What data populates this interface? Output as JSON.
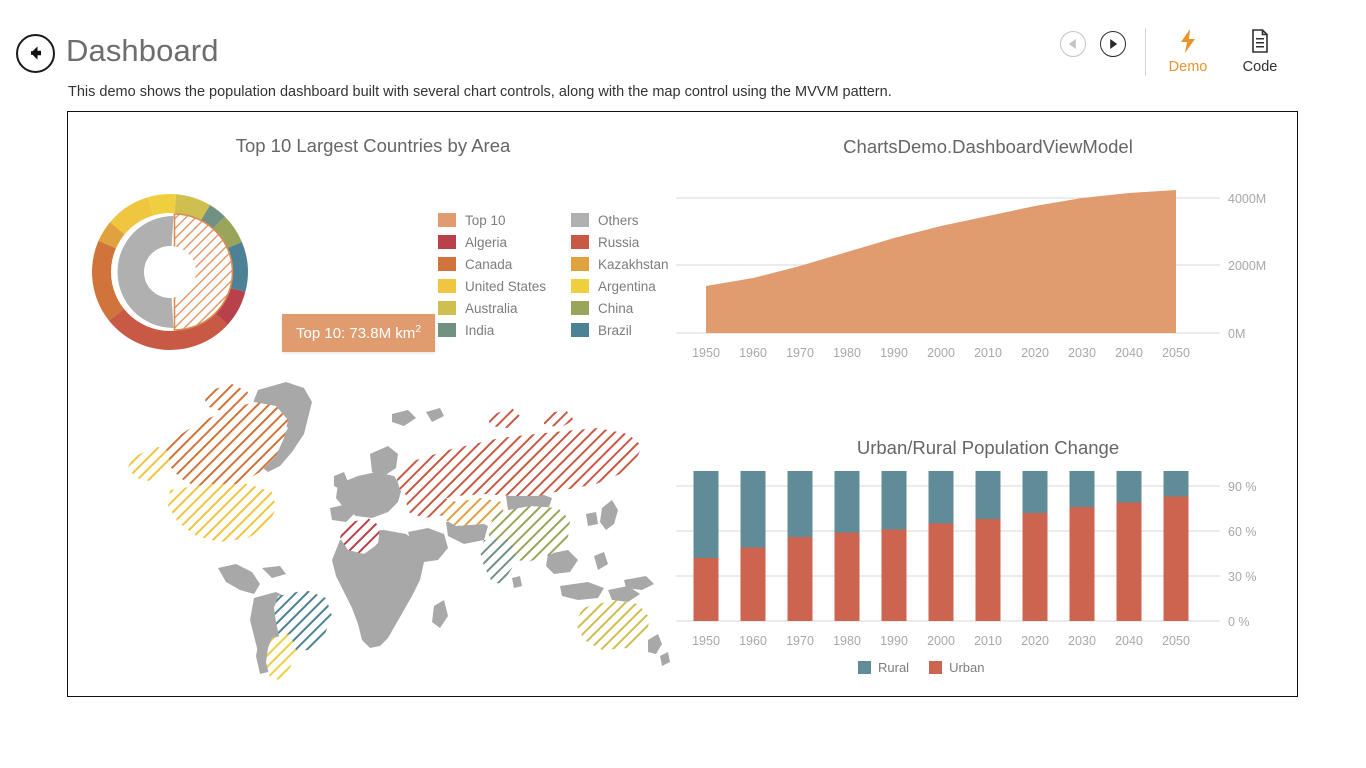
{
  "header": {
    "back_icon": "back-arrow-icon",
    "title": "Dashboard",
    "description": "This demo shows the population dashboard built with several chart controls, along with the map control using the MVVM pattern.",
    "prev_icon": "prev-arrow-icon",
    "next_icon": "next-arrow-icon",
    "modes": [
      {
        "label": "Demo",
        "icon": "lightning-bolt-icon",
        "active": true,
        "color": "#e8952e"
      },
      {
        "label": "Code",
        "icon": "document-icon",
        "active": false,
        "color": "#303030"
      }
    ]
  },
  "colors": {
    "top10": "#e09c6f",
    "others": "#b0b0b0",
    "algeria": "#b8414b",
    "russia": "#c85a45",
    "canada": "#d1743c",
    "kazakhstan": "#dfa23e",
    "united_states": "#f0c53f",
    "argentina": "#f0cf3f",
    "australia": "#cfbf4e",
    "china": "#9aa55c",
    "india": "#719183",
    "brazil": "#4d8296",
    "rural": "#5f8c96",
    "urban": "#cc6450",
    "map_base": "#a8a8a8",
    "panel_border": "#111111",
    "accent": "#e8952e"
  },
  "chart_data": [
    {
      "type": "pie",
      "title": "Top 10 Largest Countries by Area",
      "name": "top-10-largest-countries-donut",
      "tooltip": {
        "text": "Top 10: 73.8M km",
        "superscript": "2"
      },
      "inner_ring": {
        "labels": [
          "Top 10",
          "Others"
        ],
        "values": [
          73.8,
          75.2
        ],
        "unit": "M km²",
        "colors": [
          "#e09c6f",
          "#b0b0b0"
        ],
        "selected": "Top 10"
      },
      "outer_ring": {
        "labels": [
          "Russia",
          "Canada",
          "United States",
          "China",
          "Brazil",
          "Australia",
          "India",
          "Argentina",
          "Kazakhstan",
          "Algeria"
        ],
        "values": [
          17.1,
          10.0,
          9.6,
          9.6,
          8.5,
          7.7,
          3.3,
          2.8,
          2.7,
          2.4
        ],
        "unit": "M km²",
        "colors": [
          "#c85a45",
          "#d1743c",
          "#f0c53f",
          "#9aa55c",
          "#4d8296",
          "#cfbf4e",
          "#719183",
          "#f0cf3f",
          "#dfa23e",
          "#b8414b"
        ]
      },
      "legend": [
        {
          "label": "Top 10",
          "color": "#e09c6f"
        },
        {
          "label": "Others",
          "color": "#b0b0b0"
        },
        {
          "label": "Algeria",
          "color": "#b8414b"
        },
        {
          "label": "Russia",
          "color": "#c85a45"
        },
        {
          "label": "Canada",
          "color": "#d1743c"
        },
        {
          "label": "Kazakhstan",
          "color": "#dfa23e"
        },
        {
          "label": "United States",
          "color": "#f0c53f"
        },
        {
          "label": "Argentina",
          "color": "#f0cf3f"
        },
        {
          "label": "Australia",
          "color": "#cfbf4e"
        },
        {
          "label": "China",
          "color": "#9aa55c"
        },
        {
          "label": "India",
          "color": "#719183"
        },
        {
          "label": "Brazil",
          "color": "#4d8296"
        }
      ],
      "legend_position": "right"
    },
    {
      "type": "area",
      "title": "ChartsDemo.DashboardViewModel",
      "name": "world-population-area-chart",
      "x": [
        1950,
        1960,
        1970,
        1980,
        1990,
        2000,
        2010,
        2020,
        2030,
        2040,
        2050
      ],
      "xlabel": "",
      "ylabel": "",
      "values": [
        1400,
        1650,
        2000,
        2400,
        2800,
        3150,
        3450,
        3750,
        3980,
        4130,
        4220
      ],
      "ytick_labels": [
        "0M",
        "2000M",
        "4000M"
      ],
      "ytick_values": [
        0,
        2000,
        4000
      ],
      "ylim": [
        0,
        4500
      ],
      "grid": true,
      "color": "#e09c6f",
      "legend_position": "none"
    },
    {
      "type": "bar",
      "title": "Urban/Rural Population Change",
      "name": "urban-rural-population-stacked-bar",
      "stacked": true,
      "categories": [
        "1950",
        "1960",
        "1970",
        "1980",
        "1990",
        "2000",
        "2010",
        "2020",
        "2030",
        "2040",
        "2050"
      ],
      "series": [
        {
          "name": "Urban",
          "color": "#cc6450",
          "values": [
            42,
            49,
            56,
            59,
            61,
            65,
            68,
            72,
            76,
            79,
            83
          ]
        },
        {
          "name": "Rural",
          "color": "#5f8c96",
          "values": [
            58,
            51,
            44,
            41,
            39,
            35,
            32,
            28,
            24,
            21,
            17
          ]
        }
      ],
      "ytick_labels": [
        "0 %",
        "30 %",
        "60 %",
        "90 %"
      ],
      "ytick_values": [
        0,
        30,
        60,
        90
      ],
      "ylim": [
        0,
        100
      ],
      "xlabel": "",
      "ylabel": "",
      "grid": true,
      "legend": [
        {
          "label": "Rural",
          "color": "#5f8c96"
        },
        {
          "label": "Urban",
          "color": "#cc6450"
        }
      ],
      "legend_position": "bottom"
    }
  ],
  "map": {
    "name": "world-population-map",
    "base_color": "#a8a8a8",
    "highlighted_countries": [
      {
        "name": "Canada",
        "color": "#d1743c"
      },
      {
        "name": "United States",
        "color": "#f0c53f"
      },
      {
        "name": "Russia",
        "color": "#c85a45"
      },
      {
        "name": "Kazakhstan",
        "color": "#dfa23e"
      },
      {
        "name": "China",
        "color": "#9aa55c"
      },
      {
        "name": "India",
        "color": "#719183"
      },
      {
        "name": "Brazil",
        "color": "#4d8296"
      },
      {
        "name": "Argentina",
        "color": "#f0cf3f"
      },
      {
        "name": "Australia",
        "color": "#cfbf4e"
      },
      {
        "name": "Algeria",
        "color": "#b8414b"
      }
    ]
  }
}
